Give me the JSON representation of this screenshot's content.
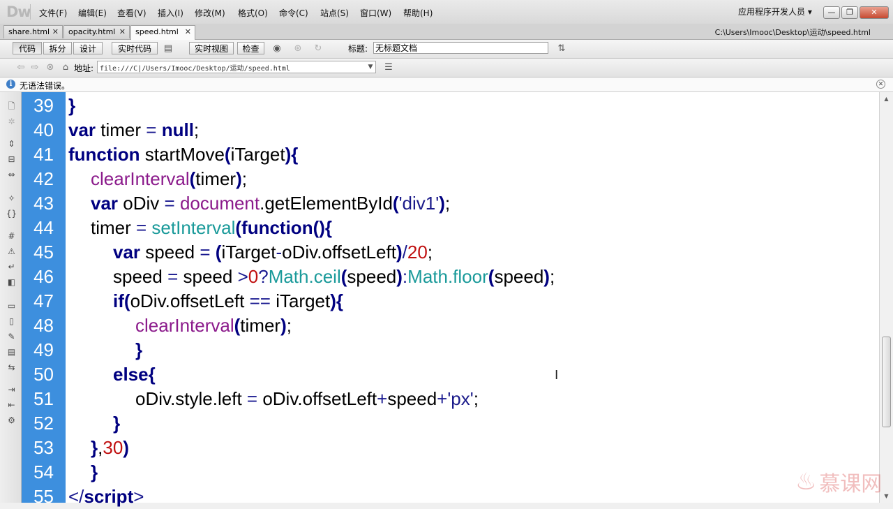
{
  "app": {
    "logo": "Dw",
    "workspace": "应用程序开发人员 ▾"
  },
  "menu": [
    "文件(F)",
    "编辑(E)",
    "查看(V)",
    "插入(I)",
    "修改(M)",
    "格式(O)",
    "命令(C)",
    "站点(S)",
    "窗口(W)",
    "帮助(H)"
  ],
  "window_buttons": {
    "minimize": "—",
    "restore": "❐",
    "close": "✕"
  },
  "tabs": [
    {
      "label": "share.html",
      "close": "✕"
    },
    {
      "label": "opacity.html",
      "close": "✕"
    },
    {
      "label": "speed.html",
      "close": "✕",
      "active": true
    }
  ],
  "file_path": "C:\\Users\\Imooc\\Desktop\\运动\\speed.html",
  "toolbar": {
    "view_buttons": [
      "代码",
      "拆分",
      "设计"
    ],
    "live_code": "实时代码",
    "live_view": "实时视图",
    "inspect": "检查",
    "title_label": "标题:",
    "title_value": "无标题文档"
  },
  "address": {
    "label": "地址:",
    "value": "file:///C|/Users/Imooc/Desktop/运动/speed.html"
  },
  "info": {
    "message": "无语法错误。"
  },
  "code": {
    "lines": [
      {
        "n": "39",
        "tokens": [
          [
            "bp",
            "}"
          ]
        ]
      },
      {
        "n": "40",
        "tokens": [
          [
            "kw",
            "var"
          ],
          [
            "",
            " timer "
          ],
          [
            "op",
            "="
          ],
          [
            "",
            " "
          ],
          [
            "kw",
            "null"
          ],
          [
            "",
            ";"
          ]
        ]
      },
      {
        "n": "41",
        "tokens": [
          [
            "kw",
            "function"
          ],
          [
            "",
            " startMove"
          ],
          [
            "bp",
            "("
          ],
          [
            "",
            "iTarget"
          ],
          [
            "bp",
            ")"
          ],
          [
            "bp",
            "{"
          ]
        ]
      },
      {
        "n": "42",
        "tokens": [
          [
            "fn",
            "clearInterval"
          ],
          [
            "bp",
            "("
          ],
          [
            "",
            "timer"
          ],
          [
            "bp",
            ")"
          ],
          [
            "",
            ";"
          ]
        ]
      },
      {
        "n": "43",
        "tokens": [
          [
            "kw",
            "var"
          ],
          [
            "",
            " oDiv "
          ],
          [
            "op",
            "="
          ],
          [
            "",
            " "
          ],
          [
            "fn",
            "document"
          ],
          [
            "",
            ".getElementById"
          ],
          [
            "bp",
            "("
          ],
          [
            "str",
            "'div1'"
          ],
          [
            "bp",
            ")"
          ],
          [
            "",
            ";"
          ]
        ]
      },
      {
        "n": "44",
        "tokens": [
          [
            "",
            "timer "
          ],
          [
            "op",
            "="
          ],
          [
            "",
            " "
          ],
          [
            "bi",
            "setInterval"
          ],
          [
            "bp",
            "("
          ],
          [
            "kw",
            "function"
          ],
          [
            "bp",
            "()"
          ],
          [
            "bp",
            "{"
          ]
        ]
      },
      {
        "n": "45",
        "tokens": [
          [
            "kw",
            "var"
          ],
          [
            "",
            " speed "
          ],
          [
            "op",
            "="
          ],
          [
            "",
            " "
          ],
          [
            "bp",
            "("
          ],
          [
            "",
            "iTarget"
          ],
          [
            "op",
            "-"
          ],
          [
            "",
            "oDiv.offsetLeft"
          ],
          [
            "bp",
            ")"
          ],
          [
            "op",
            "/"
          ],
          [
            "num",
            "20"
          ],
          [
            "",
            ";"
          ]
        ]
      },
      {
        "n": "46",
        "tokens": [
          [
            "",
            "speed "
          ],
          [
            "op",
            "="
          ],
          [
            "",
            " speed "
          ],
          [
            "op",
            ">"
          ],
          [
            "num",
            "0"
          ],
          [
            "op",
            "?"
          ],
          [
            "bi",
            "Math.ceil"
          ],
          [
            "bp",
            "("
          ],
          [
            "",
            "speed"
          ],
          [
            "bp",
            ")"
          ],
          [
            "op",
            ":"
          ],
          [
            "bi",
            "Math.floor"
          ],
          [
            "bp",
            "("
          ],
          [
            "",
            "speed"
          ],
          [
            "bp",
            ")"
          ],
          [
            "",
            ";"
          ]
        ]
      },
      {
        "n": "47",
        "tokens": [
          [
            "kw",
            "if"
          ],
          [
            "bp",
            "("
          ],
          [
            "",
            "oDiv.offsetLeft "
          ],
          [
            "op",
            "=="
          ],
          [
            "",
            " iTarget"
          ],
          [
            "bp",
            ")"
          ],
          [
            "bp",
            "{"
          ]
        ]
      },
      {
        "n": "48",
        "tokens": [
          [
            "fn",
            "clearInterval"
          ],
          [
            "bp",
            "("
          ],
          [
            "",
            "timer"
          ],
          [
            "bp",
            ")"
          ],
          [
            "",
            ";"
          ]
        ]
      },
      {
        "n": "49",
        "tokens": [
          [
            "bp",
            "}"
          ]
        ]
      },
      {
        "n": "50",
        "tokens": [
          [
            "kw",
            "else"
          ],
          [
            "bp",
            "{"
          ]
        ]
      },
      {
        "n": "51",
        "tokens": [
          [
            "",
            "oDiv.style.left "
          ],
          [
            "op",
            "="
          ],
          [
            "",
            " oDiv.offsetLeft"
          ],
          [
            "op",
            "+"
          ],
          [
            "",
            "speed"
          ],
          [
            "op",
            "+"
          ],
          [
            "str",
            "'px'"
          ],
          [
            "",
            ";"
          ]
        ]
      },
      {
        "n": "52",
        "tokens": [
          [
            "bp",
            "}"
          ]
        ]
      },
      {
        "n": "53",
        "tokens": [
          [
            "bp",
            "}"
          ],
          [
            "",
            ","
          ],
          [
            "num",
            "30"
          ],
          [
            "bp",
            ")"
          ]
        ]
      },
      {
        "n": "54",
        "tokens": [
          [
            "bp",
            "}"
          ]
        ]
      },
      {
        "n": "55",
        "tokens": [
          [
            "op",
            "</"
          ],
          [
            "kw",
            "script"
          ],
          [
            "op",
            ">"
          ]
        ]
      }
    ]
  },
  "cursor_glyph": "I",
  "watermark": "慕课网",
  "colors": {
    "gutter": "#3d8fde",
    "keyword": "#000080",
    "function": "#8b1a8b",
    "builtin": "#1a9a9a",
    "number": "#c01010"
  }
}
